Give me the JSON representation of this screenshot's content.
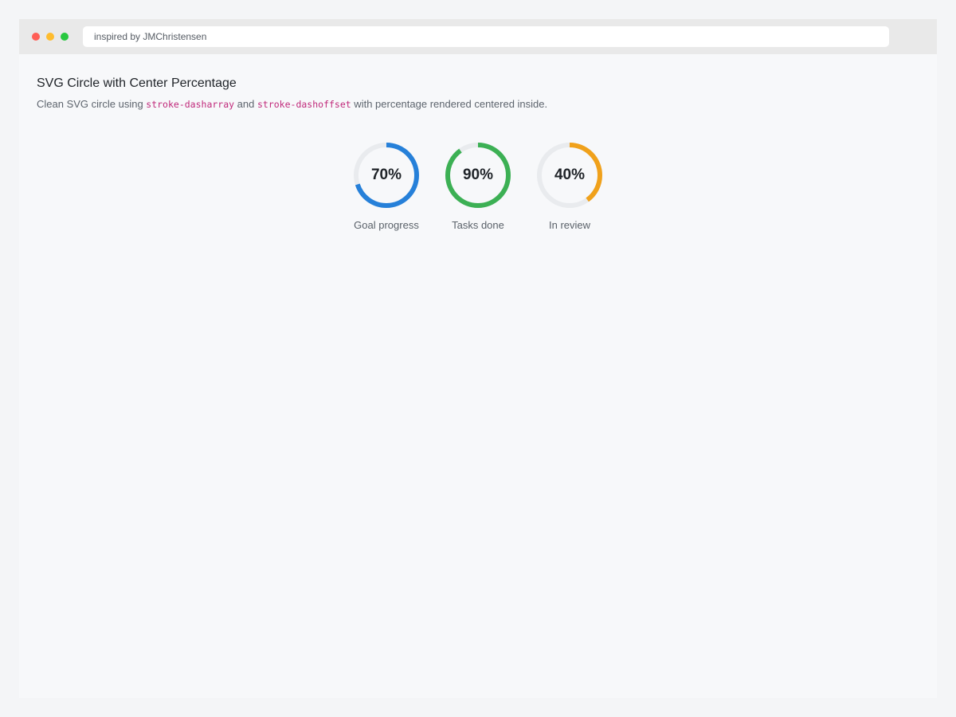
{
  "window": {
    "url_text": "inspired by JMChristensen",
    "traffic_lights": {
      "close": "#ff5f57",
      "minimize": "#febc2e",
      "maximize": "#28c840"
    }
  },
  "page": {
    "title": "SVG Circle with Center Percentage",
    "subtitle": {
      "prefix": "Clean SVG circle using ",
      "code1": "stroke-dasharray",
      "middle": " and ",
      "code2": "stroke-dashoffset",
      "suffix": " with percentage rendered centered inside."
    }
  },
  "gauges": [
    {
      "value": 70,
      "text": "70%",
      "label": "Goal progress",
      "color": "#2680d9"
    },
    {
      "value": 90,
      "text": "90%",
      "label": "Tasks done",
      "color": "#3cb054"
    },
    {
      "value": 40,
      "text": "40%",
      "label": "In review",
      "color": "#f0a11b"
    }
  ],
  "track_color": "#e9ebee"
}
